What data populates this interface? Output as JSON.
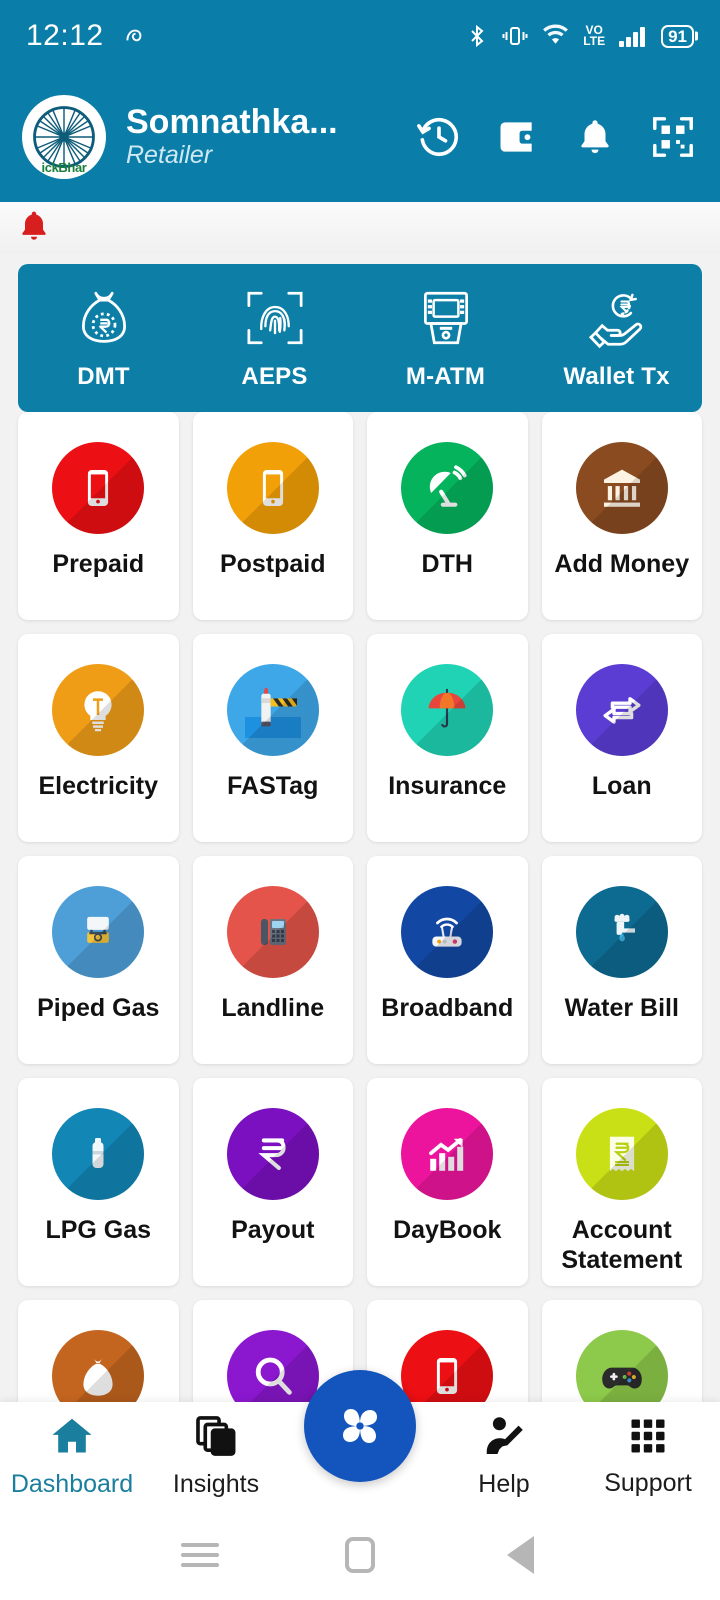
{
  "status_bar": {
    "time": "12:12",
    "left_icons": [
      "spiral-notification-icon"
    ],
    "right_icons": [
      "bluetooth-icon",
      "vibrate-icon",
      "wifi-icon",
      "volte-icon",
      "signal-bars-icon"
    ],
    "volte_top": "VO",
    "volte_bottom": "LTE",
    "battery_percent": "91"
  },
  "header": {
    "logo_text": "ickBhar",
    "logo_icon": "ashoka-chakra-icon",
    "user_name": "Somnathka...",
    "user_role": "Retailer",
    "icons": [
      {
        "name": "history-icon",
        "label": "History"
      },
      {
        "name": "wallet-icon",
        "label": "Wallet"
      },
      {
        "name": "bell-icon",
        "label": "Notifications"
      },
      {
        "name": "qr-scan-icon",
        "label": "Scan QR"
      }
    ]
  },
  "notification_strip": {
    "icon": "red-bell-icon",
    "text": ""
  },
  "quick_actions": {
    "background": "#0d7fa6",
    "items": [
      {
        "label": "DMT",
        "icon": "money-bag-rupee-icon"
      },
      {
        "label": "AEPS",
        "icon": "fingerprint-scan-icon"
      },
      {
        "label": "M-ATM",
        "icon": "atm-machine-icon"
      },
      {
        "label": "Wallet Tx",
        "icon": "hand-rupee-coin-icon"
      }
    ]
  },
  "services": [
    {
      "label": "Prepaid",
      "icon": "smartphone-icon",
      "color": "#ec0f13"
    },
    {
      "label": "Postpaid",
      "icon": "smartphone-icon",
      "color": "#f2a007"
    },
    {
      "label": "DTH",
      "icon": "satellite-dish-icon",
      "color": "#04b35c"
    },
    {
      "label": "Add Money",
      "icon": "bank-building-icon",
      "color": "#8a4b21"
    },
    {
      "label": "Electricity",
      "icon": "light-bulb-icon",
      "color": "#ef9d17"
    },
    {
      "label": "FASTag",
      "icon": "toll-barrier-icon",
      "color": "#3ea7e8"
    },
    {
      "label": "Insurance",
      "icon": "umbrella-icon",
      "color": "#1fd3b4"
    },
    {
      "label": "Loan",
      "icon": "exchange-arrows-icon",
      "color": "#5b3dd4"
    },
    {
      "label": "Piped Gas",
      "icon": "gas-meter-icon",
      "color": "#4e9fd8"
    },
    {
      "label": "Landline",
      "icon": "desk-phone-icon",
      "color": "#e4544a"
    },
    {
      "label": "Broadband",
      "icon": "wifi-router-icon",
      "color": "#1248a3"
    },
    {
      "label": "Water Bill",
      "icon": "water-tap-icon",
      "color": "#0d6a91"
    },
    {
      "label": "LPG Gas",
      "icon": "gas-cylinder-icon",
      "color": "#1286b5"
    },
    {
      "label": "Payout",
      "icon": "rupee-icon",
      "color": "#7a10c0"
    },
    {
      "label": "DayBook",
      "icon": "bar-chart-up-icon",
      "color": "#ec149c"
    },
    {
      "label": "Account Statement",
      "icon": "receipt-rupee-icon",
      "color": "#cae016"
    },
    {
      "label": "",
      "icon": "money-bag-icon",
      "color": "#c4651f"
    },
    {
      "label": "",
      "icon": "magnifier-icon",
      "color": "#8b17cf"
    },
    {
      "label": "",
      "icon": "mobile-recharge-icon",
      "color": "#ec0f13"
    },
    {
      "label": "",
      "icon": "game-controller-icon",
      "color": "#8dc94a"
    }
  ],
  "bottom_nav": {
    "active": "Dashboard",
    "fab_icon": "pinwheel-fan-icon",
    "fab_color": "#1455bd",
    "items": [
      {
        "label": "Dashboard",
        "icon": "home-icon",
        "active": true
      },
      {
        "label": "Insights",
        "icon": "layers-icon",
        "active": false
      },
      {
        "label": "Help",
        "icon": "person-edit-icon",
        "active": false
      },
      {
        "label": "Support",
        "icon": "grid-apps-icon",
        "active": false
      }
    ]
  },
  "system_nav": {
    "items": [
      {
        "name": "recents-button",
        "label": "Recents"
      },
      {
        "name": "home-button",
        "label": "Home"
      },
      {
        "name": "back-button",
        "label": "Back"
      }
    ]
  }
}
